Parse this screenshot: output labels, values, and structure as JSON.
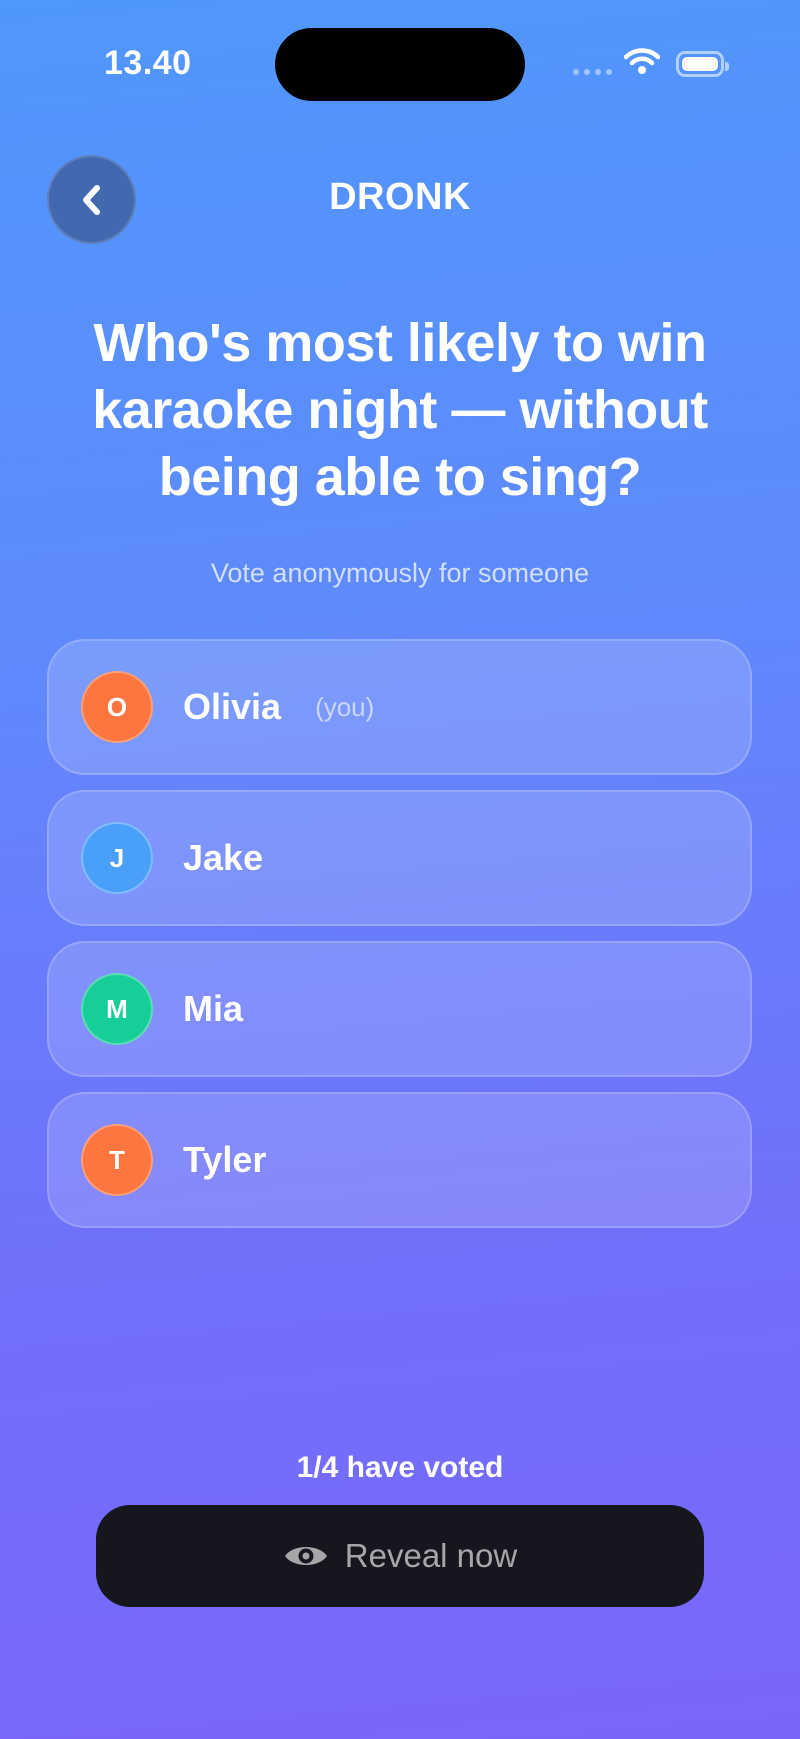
{
  "status_bar": {
    "time": "13.40"
  },
  "header": {
    "title": "DRONK",
    "back_icon": "chevron-left-icon"
  },
  "question": "Who's most likely to win karaoke night — without being able to sing?",
  "subtitle": "Vote anonymously for someone",
  "players": [
    {
      "initial": "O",
      "name": "Olivia",
      "tag": "(you)",
      "color": "#fd7640"
    },
    {
      "initial": "J",
      "name": "Jake",
      "tag": "",
      "color": "#4aa0f8"
    },
    {
      "initial": "M",
      "name": "Mia",
      "tag": "",
      "color": "#17cd98"
    },
    {
      "initial": "T",
      "name": "Tyler",
      "tag": "",
      "color": "#fd7640"
    }
  ],
  "vote_status": "1/4 have voted",
  "reveal_button": {
    "label": "Reveal now",
    "icon": "eye-icon"
  }
}
